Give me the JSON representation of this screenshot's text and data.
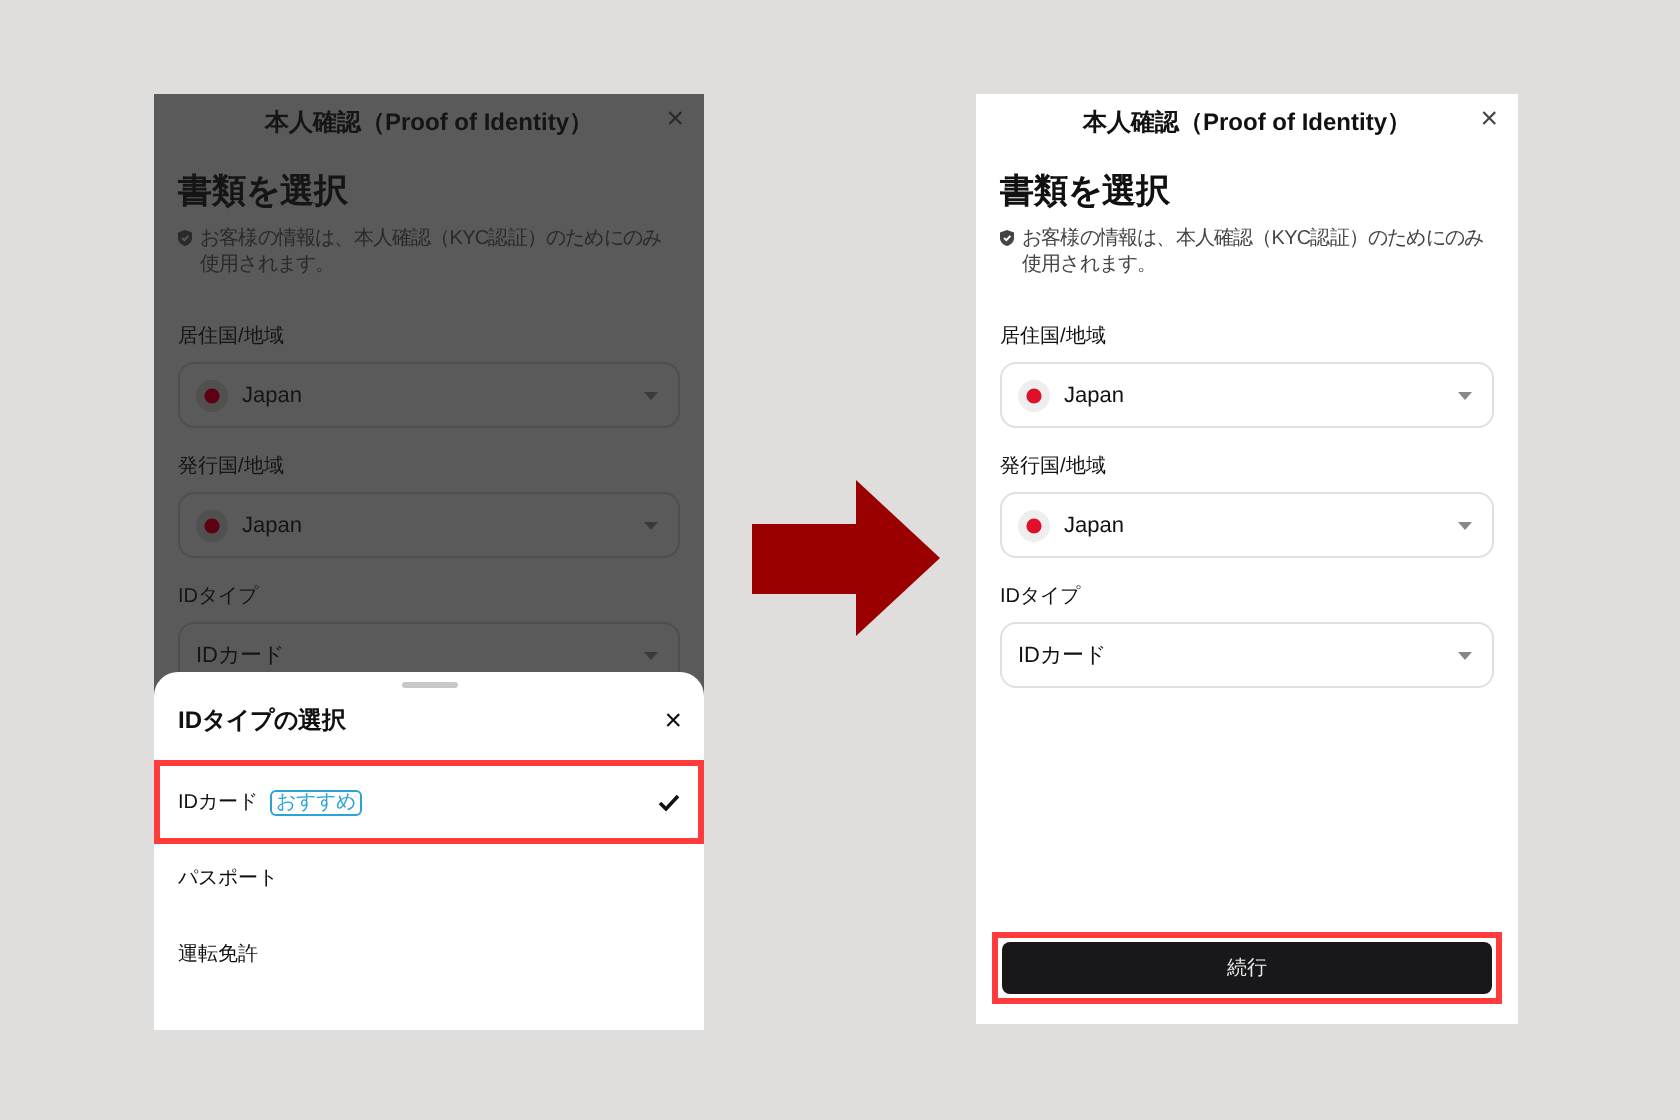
{
  "screens": [
    {
      "dimmed": true,
      "title": "本人確認（Proof of Identity）",
      "close": "×",
      "heading": "書類を選択",
      "notice": "お客様の情報は、本人確認（KYC認証）のためにのみ使用されます。",
      "fields": [
        {
          "kind": "country",
          "label": "居住国/地域",
          "value": "Japan"
        },
        {
          "kind": "country",
          "label": "発行国/地域",
          "value": "Japan"
        },
        {
          "kind": "select",
          "label": "IDタイプ",
          "value": "IDカード"
        }
      ],
      "sheet": {
        "title": "IDタイプの選択",
        "close": "×",
        "options": [
          {
            "label": "IDカード",
            "badge": "おすすめ",
            "selected": true,
            "highlighted": true
          },
          {
            "label": "パスポート",
            "selected": false,
            "highlighted": false
          },
          {
            "label": "運転免許",
            "selected": false,
            "highlighted": false
          }
        ]
      }
    },
    {
      "dimmed": false,
      "title": "本人確認（Proof of Identity）",
      "close": "×",
      "heading": "書類を選択",
      "notice": "お客様の情報は、本人確認（KYC認証）のためにのみ使用されます。",
      "fields": [
        {
          "kind": "country",
          "label": "居住国/地域",
          "value": "Japan"
        },
        {
          "kind": "country",
          "label": "発行国/地域",
          "value": "Japan"
        },
        {
          "kind": "select",
          "label": "IDタイプ",
          "value": "IDカード"
        }
      ],
      "continue_button": {
        "label": "続行",
        "highlighted": true
      }
    }
  ]
}
